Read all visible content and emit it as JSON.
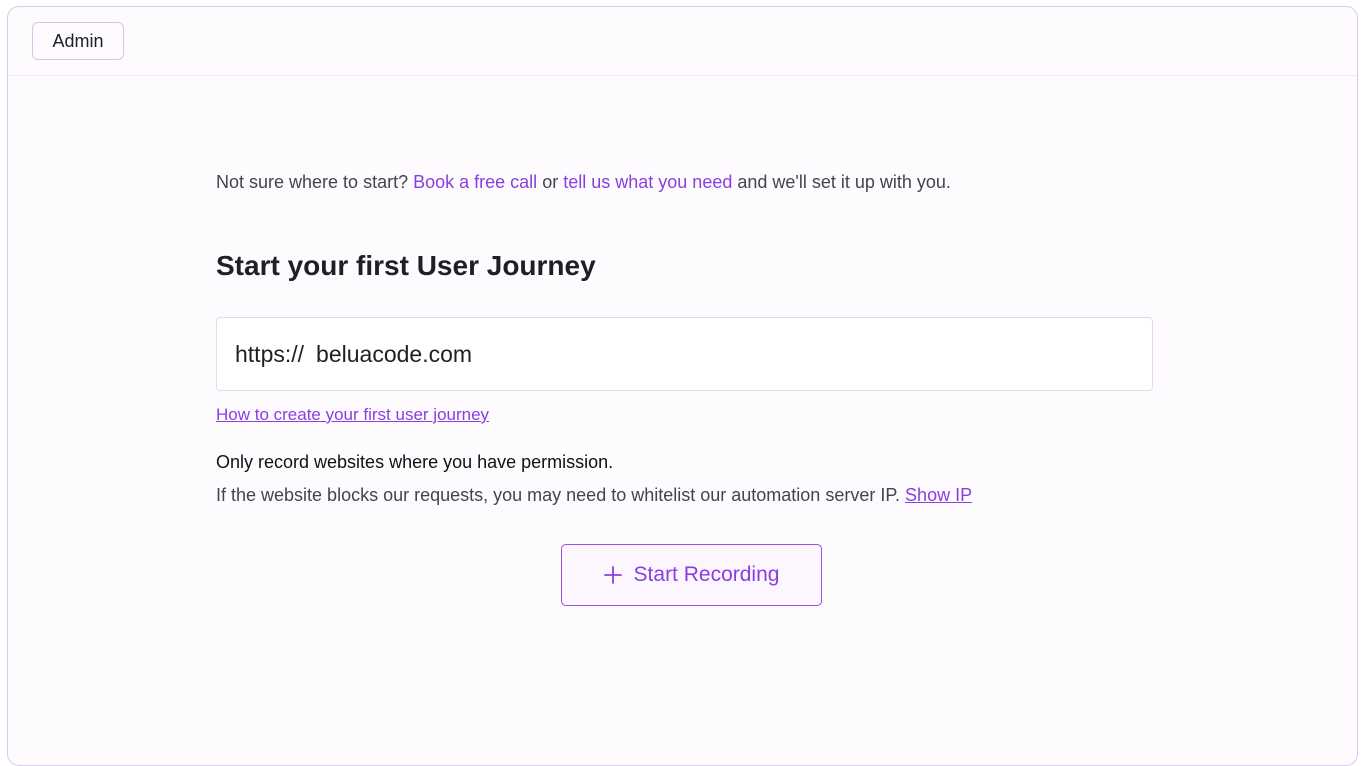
{
  "header": {
    "admin_label": "Admin"
  },
  "intro": {
    "prefix": "Not sure where to start?",
    "book_call_link": "Book a free call",
    "or_text": "or",
    "tell_us_link": "tell us what you need",
    "suffix": "and we'll set it up with you."
  },
  "journey": {
    "heading": "Start your first User Journey",
    "url_prefix": "https://",
    "url_value": "beluacode.com",
    "help_link": "How to create your first user journey",
    "permission_note": "Only record websites where you have permission.",
    "whitelist_note": "If the website blocks our requests, you may need to whitelist our automation server IP.",
    "show_ip_link": "Show IP",
    "start_button_label": "Start Recording",
    "start_button_icon": "plus-icon"
  },
  "colors": {
    "accent": "#8a3ee0",
    "border": "#dcc8ef",
    "background": "#fdfbfe",
    "text": "#1f1f24"
  }
}
